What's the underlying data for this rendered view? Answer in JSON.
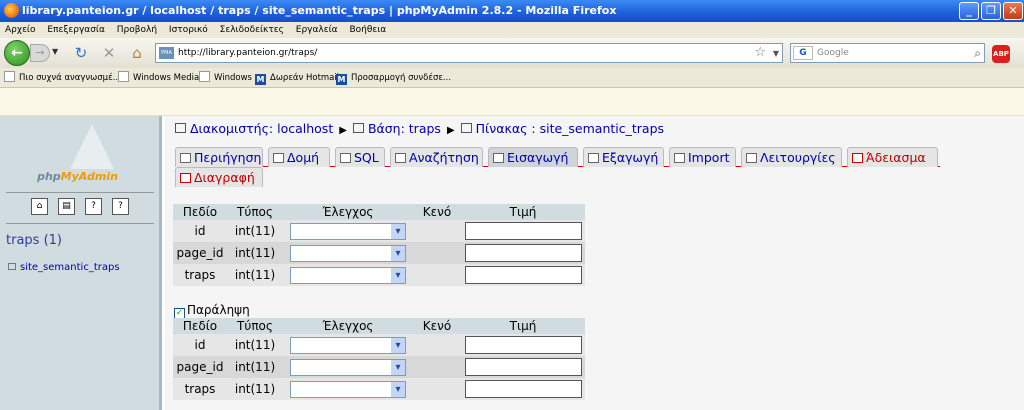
{
  "window": {
    "title": "library.panteion.gr / localhost / traps / site_semantic_traps | phpMyAdmin 2.8.2 - Mozilla Firefox"
  },
  "menu": [
    "Αρχείο",
    "Επεξεργασία",
    "Προβολή",
    "Ιστορικό",
    "Σελιδοδείκτες",
    "Εργαλεία",
    "Βοήθεια"
  ],
  "nav": {
    "url": "http://library.panteion.gr/traps/",
    "search_placeholder": "Google",
    "adblock_label": "ABP"
  },
  "bookmarks": [
    "Πιο συχνά αναγνωσμέ...",
    "Windows Media",
    "Windows",
    "Δωρεάν Hotmail",
    "Προσαρμογή συνδέσε..."
  ],
  "sidebar": {
    "logo_pre": "php",
    "logo_post": "MyAdmin",
    "db": "traps (1)",
    "table": "site_semantic_traps"
  },
  "breadcrumb": {
    "server": "Διακομιστής: localhost",
    "db": "Βάση: traps",
    "table": "Πίνακας : site_semantic_traps"
  },
  "tabs": [
    "Περιήγηση",
    "Δομή",
    "SQL",
    "Αναζήτηση",
    "Εισαγωγή",
    "Εξαγωγή",
    "Import",
    "Λειτουργίες",
    "Άδειασμα",
    "Διαγραφή"
  ],
  "form": {
    "headers": [
      "Πεδίο",
      "Τύπος",
      "Έλεγχος",
      "Κενό",
      "Τιμή"
    ],
    "rows": [
      {
        "field": "id",
        "type": "int(11)"
      },
      {
        "field": "page_id",
        "type": "int(11)"
      },
      {
        "field": "traps",
        "type": "int(11)"
      }
    ],
    "ignore_label": "Παράληψη"
  }
}
